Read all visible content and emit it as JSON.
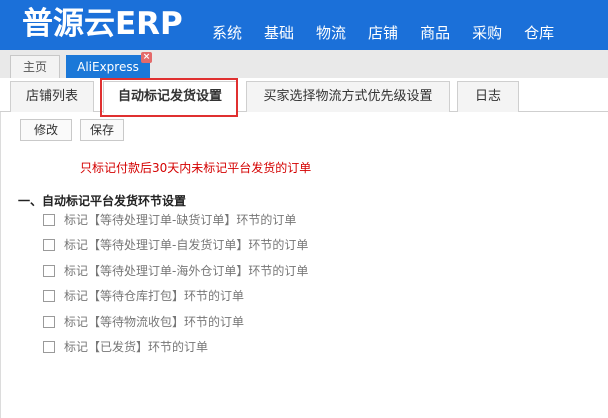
{
  "app": {
    "logo": "普源云ERP"
  },
  "nav": [
    "系统",
    "基础",
    "物流",
    "店铺",
    "商品",
    "采购",
    "仓库"
  ],
  "page_tabs": {
    "home": "主页",
    "current": "AliExpress",
    "close_glyph": "×"
  },
  "sub_tabs": [
    "店铺列表",
    "自动标记发货设置",
    "买家选择物流方式优先级设置",
    "日志"
  ],
  "toolbar": {
    "edit_label": "修改",
    "save_label": "保存"
  },
  "notice": "只标记付款后30天内未标记平台发货的订单",
  "section_title": "一、自动标记平台发货环节设置",
  "options": [
    "标记【等待处理订单-缺货订单】环节的订单",
    "标记【等待处理订单-自发货订单】环节的订单",
    "标记【等待处理订单-海外仓订单】环节的订单",
    "标记【等待仓库打包】环节的订单",
    "标记【等待物流收包】环节的订单",
    "标记【已发货】环节的订单"
  ],
  "colors": {
    "brand": "#1b70d9",
    "notice": "#d40000",
    "highlight": "#e03030"
  }
}
